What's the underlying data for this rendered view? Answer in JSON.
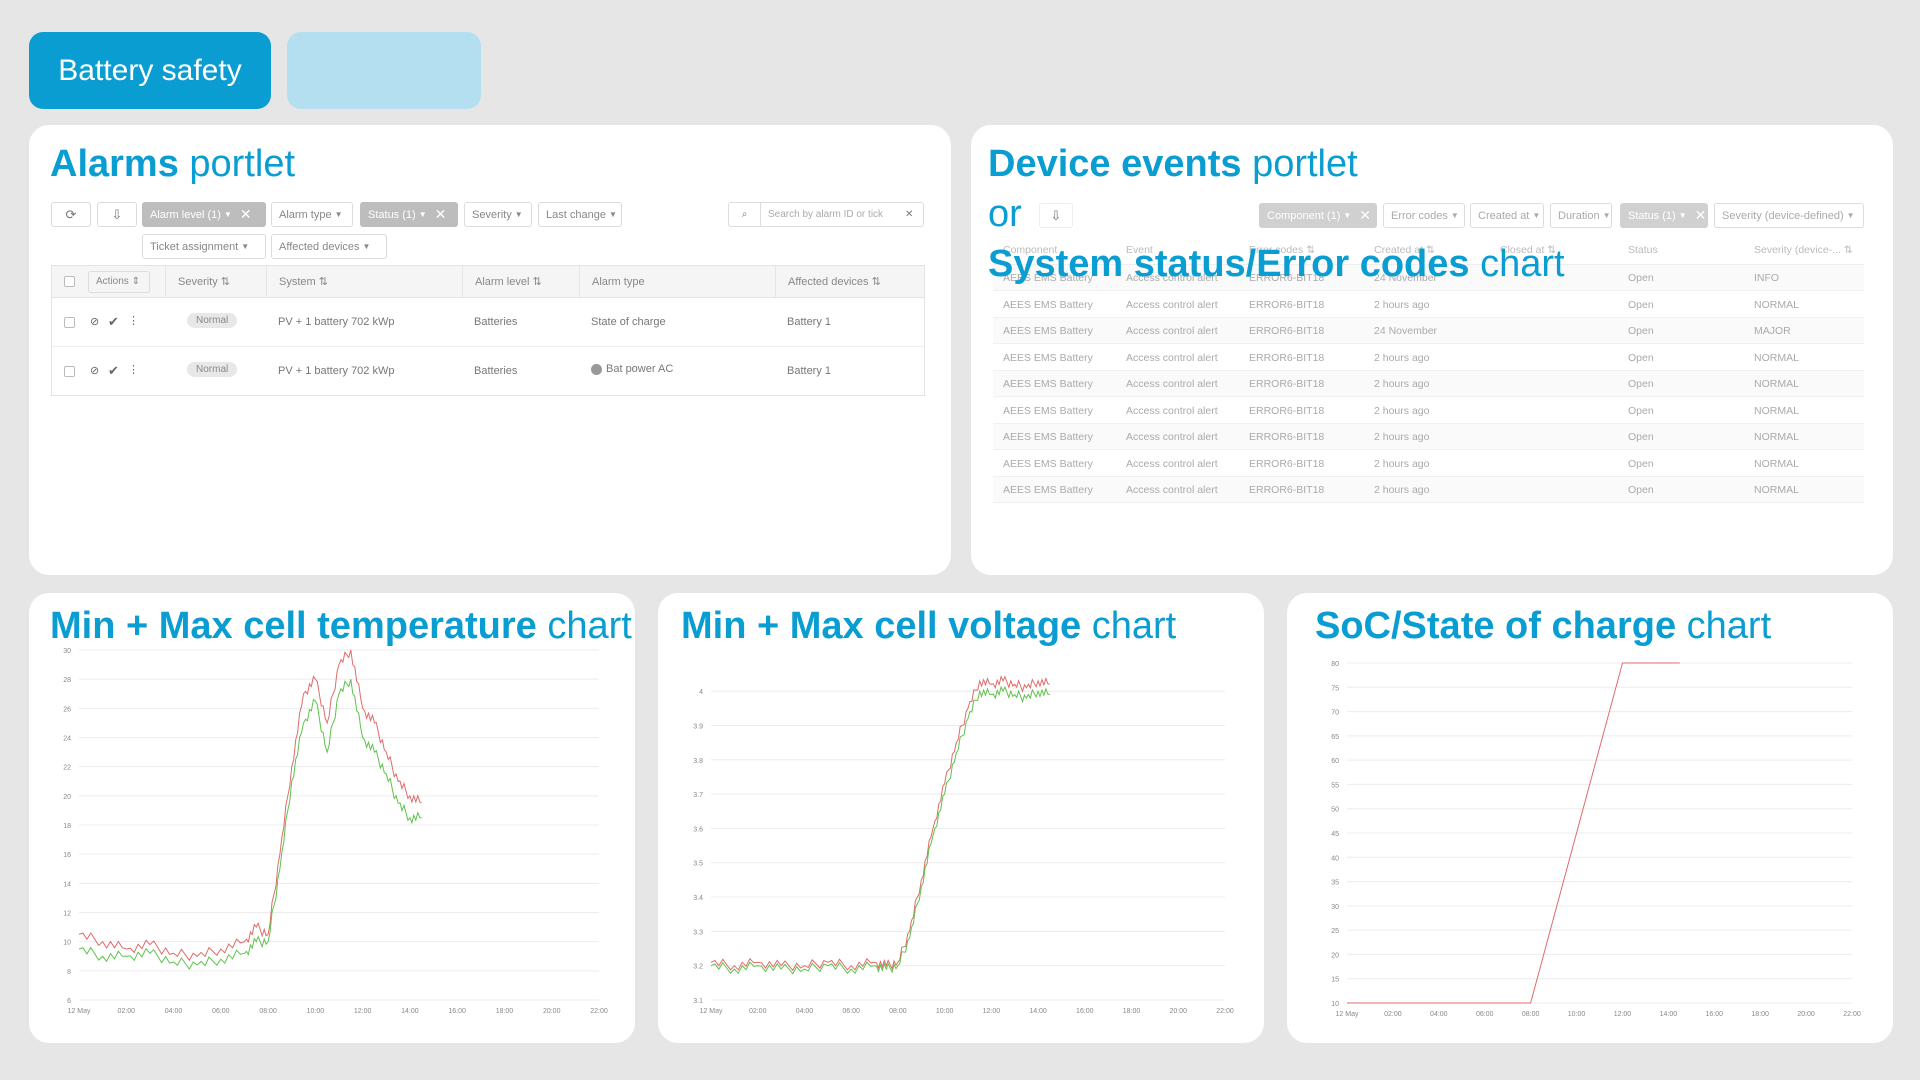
{
  "tabs": {
    "active_label": "Battery safety"
  },
  "alarms": {
    "title_bold": "Alarms",
    "title_rest": "portlet",
    "toolbar": {
      "alarm_level": "Alarm level (1)",
      "alarm_type": "Alarm type",
      "status": "Status (1)",
      "severity": "Severity",
      "last_change": "Last change",
      "search_placeholder": "Search by alarm ID or tick",
      "ticket_assignment": "Ticket assignment",
      "affected_devices": "Affected devices"
    },
    "columns": [
      "Actions",
      "Severity",
      "System",
      "Alarm level",
      "Alarm type",
      "Affected devices"
    ],
    "rows": [
      {
        "severity": "Normal",
        "system": "PV + 1 battery 702 kWp",
        "alarm_level": "Batteries",
        "alarm_type": "State of charge",
        "affected": "Battery 1"
      },
      {
        "severity": "Normal",
        "system": "PV + 1 battery 702 kWp",
        "alarm_level": "Batteries",
        "alarm_type": "Bat power AC",
        "affected": "Battery 1"
      }
    ]
  },
  "events": {
    "title_bold": "Device events",
    "title_rest": "portlet",
    "or": "or",
    "alt_bold": "System status/Error codes",
    "alt_rest": "chart",
    "toolbar": {
      "component": "Component (1)",
      "error_codes": "Error codes",
      "created_at": "Created at",
      "duration": "Duration",
      "status": "Status (1)",
      "severity": "Severity (device-defined)"
    },
    "columns": [
      "Component",
      "Event",
      "Error codes",
      "Created at",
      "Closed at",
      "Status",
      "Severity (device-..."
    ],
    "rows": [
      {
        "component": "AEES EMS Battery",
        "event": "Access control alert",
        "code": "ERROR6-BIT18",
        "created": "24 November",
        "status": "Open",
        "severity": "INFO"
      },
      {
        "component": "AEES EMS Battery",
        "event": "Access control alert",
        "code": "ERROR6-BIT18",
        "created": "2 hours ago",
        "status": "Open",
        "severity": "NORMAL"
      },
      {
        "component": "AEES EMS Battery",
        "event": "Access control alert",
        "code": "ERROR6-BIT18",
        "created": "24 November",
        "status": "Open",
        "severity": "MAJOR"
      },
      {
        "component": "AEES EMS Battery",
        "event": "Access control alert",
        "code": "ERROR6-BIT18",
        "created": "2 hours ago",
        "status": "Open",
        "severity": "NORMAL"
      },
      {
        "component": "AEES EMS Battery",
        "event": "Access control alert",
        "code": "ERROR6-BIT18",
        "created": "2 hours ago",
        "status": "Open",
        "severity": "NORMAL"
      },
      {
        "component": "AEES EMS Battery",
        "event": "Access control alert",
        "code": "ERROR6-BIT18",
        "created": "2 hours ago",
        "status": "Open",
        "severity": "NORMAL"
      },
      {
        "component": "AEES EMS Battery",
        "event": "Access control alert",
        "code": "ERROR6-BIT18",
        "created": "2 hours ago",
        "status": "Open",
        "severity": "NORMAL"
      },
      {
        "component": "AEES EMS Battery",
        "event": "Access control alert",
        "code": "ERROR6-BIT18",
        "created": "2 hours ago",
        "status": "Open",
        "severity": "NORMAL"
      },
      {
        "component": "AEES EMS Battery",
        "event": "Access control alert",
        "code": "ERROR6-BIT18",
        "created": "2 hours ago",
        "status": "Open",
        "severity": "NORMAL"
      }
    ]
  },
  "chart_titles": {
    "temp_bold": "Min + Max cell temperature",
    "temp_rest": "chart",
    "volt_bold": "Min + Max cell voltage",
    "volt_rest": "chart",
    "soc_bold": "SoC/State of charge",
    "soc_rest": "chart"
  },
  "chart_data": [
    {
      "type": "line",
      "x_ticks": [
        "12 May",
        "02:00",
        "04:00",
        "06:00",
        "08:00",
        "10:00",
        "12:00",
        "14:00",
        "16:00",
        "18:00",
        "20:00",
        "22:00"
      ],
      "y_ticks": [
        "6",
        "8",
        "10",
        "12",
        "14",
        "16",
        "18",
        "20",
        "22",
        "24",
        "26",
        "28",
        "30"
      ],
      "ylim": [
        6,
        30
      ],
      "x_hours": [
        0,
        1,
        2,
        3,
        4,
        5,
        6,
        7,
        7.5,
        8,
        8.5,
        9,
        9.5,
        10,
        10.5,
        11,
        11.5,
        12,
        12.5,
        13,
        13.5,
        14,
        14.5
      ],
      "series": [
        {
          "color": "#e06b6b",
          "values": [
            10.5,
            10,
            9.5,
            9.8,
            9.2,
            9,
            9.5,
            10,
            11,
            10.5,
            16,
            22,
            27,
            28,
            25,
            29,
            30,
            26,
            25,
            23,
            21,
            20,
            19.5
          ]
        },
        {
          "color": "#5fc24c",
          "values": [
            9.5,
            9,
            9,
            9.2,
            8.6,
            8.4,
            8.8,
            9.2,
            10,
            10,
            15,
            21,
            25,
            26.5,
            23,
            27,
            28,
            24,
            23,
            21.5,
            19.5,
            18.5,
            18.5
          ]
        }
      ]
    },
    {
      "type": "line",
      "x_ticks": [
        "12 May",
        "02:00",
        "04:00",
        "06:00",
        "08:00",
        "10:00",
        "12:00",
        "14:00",
        "16:00",
        "18:00",
        "20:00",
        "22:00"
      ],
      "y_ticks": [
        "3.1",
        "3.2",
        "3.3",
        "3.4",
        "3.5",
        "3.6",
        "3.7",
        "3.8",
        "3.9",
        "4"
      ],
      "ylim": [
        3.1,
        4.05
      ],
      "x_hours": [
        0,
        1,
        2,
        3,
        4,
        5,
        6,
        7,
        7.5,
        8,
        8.5,
        9,
        9.5,
        10,
        10.5,
        11,
        11.5,
        12,
        12.5,
        13,
        13.5,
        14,
        14.5
      ],
      "series": [
        {
          "color": "#e06b6b",
          "values": [
            3.21,
            3.2,
            3.21,
            3.2,
            3.2,
            3.21,
            3.2,
            3.21,
            3.2,
            3.21,
            3.3,
            3.45,
            3.6,
            3.73,
            3.85,
            3.95,
            4.03,
            4.02,
            4.03,
            4.02,
            4.01,
            4.03,
            4.02
          ]
        },
        {
          "color": "#5fc24c",
          "values": [
            3.2,
            3.19,
            3.2,
            3.19,
            3.19,
            3.2,
            3.19,
            3.2,
            3.19,
            3.2,
            3.28,
            3.43,
            3.58,
            3.7,
            3.82,
            3.92,
            4.0,
            3.99,
            4.0,
            3.99,
            3.98,
            4.0,
            3.99
          ]
        }
      ]
    },
    {
      "type": "line",
      "x_ticks": [
        "12 May",
        "02:00",
        "04:00",
        "06:00",
        "08:00",
        "10:00",
        "12:00",
        "14:00",
        "16:00",
        "18:00",
        "20:00",
        "22:00"
      ],
      "y_ticks": [
        "10",
        "15",
        "20",
        "25",
        "30",
        "35",
        "40",
        "45",
        "50",
        "55",
        "60",
        "65",
        "70",
        "75",
        "80"
      ],
      "ylim": [
        10,
        80
      ],
      "x_hours": [
        0,
        8,
        12,
        14.5
      ],
      "series": [
        {
          "color": "#e06b6b",
          "values": [
            10,
            10,
            80,
            80
          ]
        }
      ]
    }
  ]
}
